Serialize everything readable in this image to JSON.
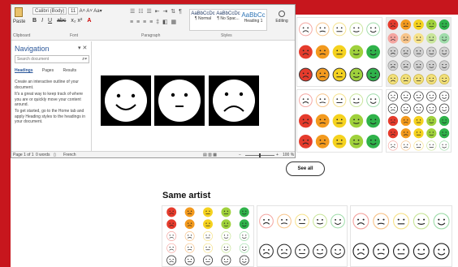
{
  "ribbon": {
    "font_name": "Calibri (Body)",
    "font_size": "11",
    "paste_label": "Paste",
    "groups": [
      "Clipboard",
      "Font",
      "Paragraph",
      "Styles"
    ],
    "styles": [
      {
        "sample": "AaBbCcDc",
        "name": "¶ Normal"
      },
      {
        "sample": "AaBbCcDc",
        "name": "¶ No Spac..."
      },
      {
        "sample": "AaBbCc",
        "name": "Heading 1"
      }
    ],
    "editing_label": "Editing"
  },
  "navigation": {
    "title": "Navigation",
    "search_placeholder": "Search document",
    "tabs": [
      "Headings",
      "Pages",
      "Results"
    ],
    "help_1": "Create an interactive outline of your document.",
    "help_2": "It's a great way to keep track of where you are or quickly move your content around.",
    "help_3": "To get started, go to the Home tab and apply Heading styles to the headings in your document."
  },
  "statusbar": {
    "page": "Page 1 of 1",
    "words": "0 words",
    "language": "French",
    "zoom": "100 %"
  },
  "faces": [
    "happy",
    "neutral",
    "sad"
  ],
  "see_all_label": "See all",
  "same_artist_label": "Same artist",
  "colors": {
    "red_frame": "#c7161d",
    "face_red": "#e53b2c",
    "face_orange": "#f39a1e",
    "face_yellow": "#f5d21f",
    "face_lime": "#9fd13c",
    "face_green": "#2fb24a"
  }
}
